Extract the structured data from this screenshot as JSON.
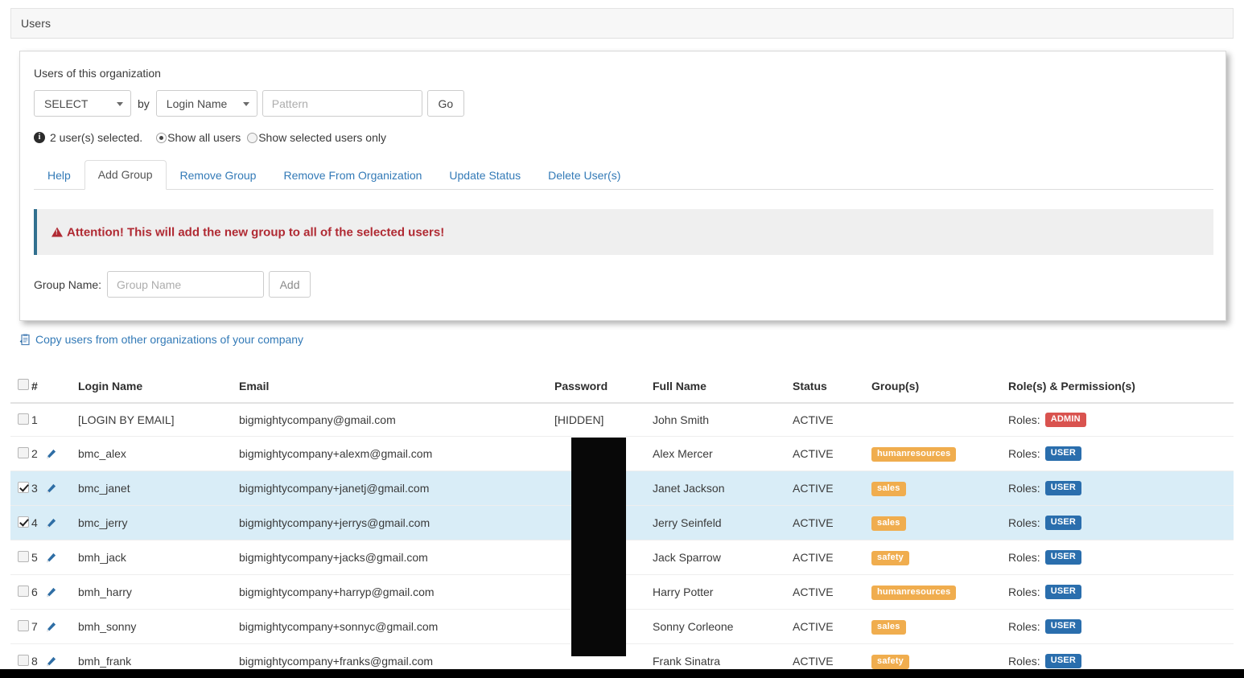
{
  "window": {
    "title": "Users"
  },
  "panel": {
    "org_label": "Users of this organization",
    "filter": {
      "select_value": "SELECT",
      "by_text": "by",
      "field_value": "Login Name",
      "pattern_placeholder": "Pattern",
      "pattern_value": "",
      "go_label": "Go"
    },
    "selection": {
      "info_glyph": "i",
      "count_text": "2 user(s) selected.",
      "radio_all_label": "Show all users",
      "radio_selected_label": "Show selected users only",
      "radio_selected_value": "all"
    },
    "tabs": [
      {
        "label": "Help",
        "active": false
      },
      {
        "label": "Add Group",
        "active": true
      },
      {
        "label": "Remove Group",
        "active": false
      },
      {
        "label": "Remove From Organization",
        "active": false
      },
      {
        "label": "Update Status",
        "active": false
      },
      {
        "label": "Delete User(s)",
        "active": false
      }
    ],
    "alert": {
      "icon": "warning-triangle-icon",
      "text": "Attention! This will add the new group to all of the selected users!"
    },
    "group_form": {
      "label": "Group Name:",
      "placeholder": "Group Name",
      "value": "",
      "add_label": "Add"
    }
  },
  "copy_link": {
    "icon": "copy-users-icon",
    "label": "Copy users from other organizations of your company"
  },
  "table": {
    "columns": [
      "",
      "#",
      "Login Name",
      "Email",
      "Password",
      "Full Name",
      "Status",
      "Group(s)",
      "Role(s) & Permission(s)"
    ],
    "roles_prefix": "Roles:",
    "rows": [
      {
        "selected": false,
        "num": "1",
        "editable": false,
        "login": "[LOGIN BY EMAIL]",
        "email": "bigmightycompany@gmail.com",
        "password": "[HIDDEN]",
        "full_name": "John Smith",
        "status": "ACTIVE",
        "group": "",
        "role": "ADMIN"
      },
      {
        "selected": false,
        "num": "2",
        "editable": true,
        "login": "bmc_alex",
        "email": "bigmightycompany+alexm@gmail.com",
        "password": "",
        "full_name": "Alex Mercer",
        "status": "ACTIVE",
        "group": "humanresources",
        "role": "USER"
      },
      {
        "selected": true,
        "num": "3",
        "editable": true,
        "login": "bmc_janet",
        "email": "bigmightycompany+janetj@gmail.com",
        "password": "",
        "full_name": "Janet Jackson",
        "status": "ACTIVE",
        "group": "sales",
        "role": "USER"
      },
      {
        "selected": true,
        "num": "4",
        "editable": true,
        "login": "bmc_jerry",
        "email": "bigmightycompany+jerrys@gmail.com",
        "password": "",
        "full_name": "Jerry Seinfeld",
        "status": "ACTIVE",
        "group": "sales",
        "role": "USER"
      },
      {
        "selected": false,
        "num": "5",
        "editable": true,
        "login": "bmh_jack",
        "email": "bigmightycompany+jacks@gmail.com",
        "password": "",
        "full_name": "Jack Sparrow",
        "status": "ACTIVE",
        "group": "safety",
        "role": "USER"
      },
      {
        "selected": false,
        "num": "6",
        "editable": true,
        "login": "bmh_harry",
        "email": "bigmightycompany+harryp@gmail.com",
        "password": "",
        "full_name": "Harry Potter",
        "status": "ACTIVE",
        "group": "humanresources",
        "role": "USER"
      },
      {
        "selected": false,
        "num": "7",
        "editable": true,
        "login": "bmh_sonny",
        "email": "bigmightycompany+sonnyc@gmail.com",
        "password": "",
        "full_name": "Sonny Corleone",
        "status": "ACTIVE",
        "group": "sales",
        "role": "USER"
      },
      {
        "selected": false,
        "num": "8",
        "editable": true,
        "login": "bmh_frank",
        "email": "bigmightycompany+franks@gmail.com",
        "password": "",
        "full_name": "Frank Sinatra",
        "status": "ACTIVE",
        "group": "safety",
        "role": "USER"
      }
    ]
  },
  "colors": {
    "link": "#337ab7",
    "group_badge": "#f0ad4e",
    "role_admin_badge": "#d9534f",
    "role_user_badge": "#2a6ead",
    "alert_text": "#b02a33",
    "selected_row": "#d9edf7"
  }
}
